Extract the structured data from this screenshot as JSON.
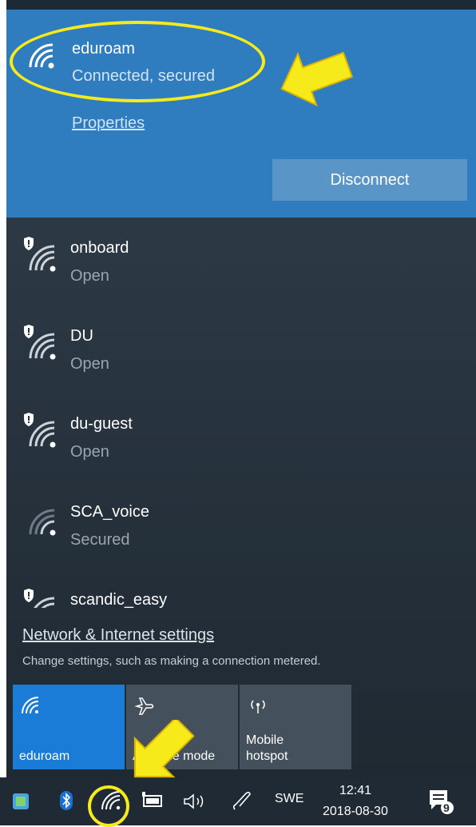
{
  "connected_network": {
    "name": "eduroam",
    "status": "Connected, secured",
    "properties_label": "Properties",
    "disconnect_label": "Disconnect"
  },
  "networks": [
    {
      "name": "onboard",
      "status": "Open",
      "shield": true
    },
    {
      "name": "DU",
      "status": "Open",
      "shield": true
    },
    {
      "name": "du-guest",
      "status": "Open",
      "shield": true
    },
    {
      "name": "SCA_voice",
      "status": "Secured",
      "shield": false
    },
    {
      "name": "scandic_easy",
      "status": "",
      "shield": true
    }
  ],
  "settings": {
    "link": "Network & Internet settings",
    "description": "Change settings, such as making a connection metered."
  },
  "quick_actions": [
    {
      "label": "eduroam",
      "icon": "wifi-icon",
      "active": true
    },
    {
      "label": "Airplane mode",
      "icon": "airplane-icon",
      "active": false
    },
    {
      "label_line1": "Mobile",
      "label_line2": "hotspot",
      "icon": "hotspot-icon",
      "active": false
    }
  ],
  "taskbar": {
    "language": "SWE",
    "time": "12:41",
    "date": "2018-08-30",
    "notification_count": "9"
  },
  "colors": {
    "connected_bg": "#2f7dbe",
    "flyout_bg": "#2a3642",
    "active_tile": "#1a7cd6",
    "annotation": "#f7ea1a"
  }
}
